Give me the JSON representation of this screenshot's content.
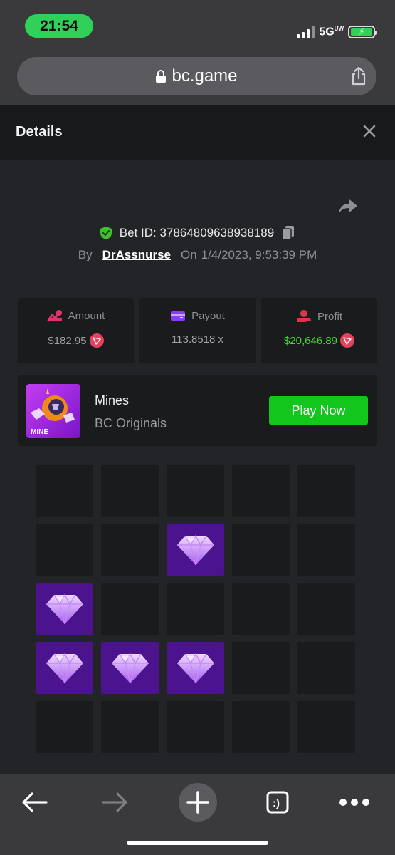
{
  "status_bar": {
    "time": "21:54",
    "network": "5G",
    "network_super": "UW",
    "battery_color": "#2fd158"
  },
  "browser": {
    "url": "bc.game",
    "icons": [
      "lock-icon",
      "share-icon"
    ]
  },
  "details": {
    "title": "Details",
    "close_icon": "close-icon"
  },
  "bet": {
    "id_label": "Bet ID: 37864809638938189",
    "by_label": "By",
    "username": "DrAssnurse",
    "on_label": "On",
    "datetime": "1/4/2023, 9:53:39 PM"
  },
  "stats": {
    "amount_label": "Amount",
    "amount_value": "$182.95",
    "payout_label": "Payout",
    "payout_value": "113.8518 x",
    "profit_label": "Profit",
    "profit_value": "$20,646.89",
    "profit_color": "#3fdc2c"
  },
  "game": {
    "name": "Mines",
    "provider": "BC Originals",
    "play_label": "Play Now",
    "thumb_text": "MINE",
    "accent": "#12c61c"
  },
  "board": {
    "rows": 5,
    "cols": 5,
    "gems": [
      [
        1,
        2
      ],
      [
        2,
        0
      ],
      [
        3,
        0
      ],
      [
        3,
        1
      ],
      [
        3,
        2
      ]
    ],
    "gem_tile_color": "#4b138e"
  },
  "toolbar": {
    "icons": [
      "back-arrow-icon",
      "forward-arrow-icon",
      "new-tab-plus-icon",
      "tabs-icon",
      "more-icon"
    ]
  }
}
